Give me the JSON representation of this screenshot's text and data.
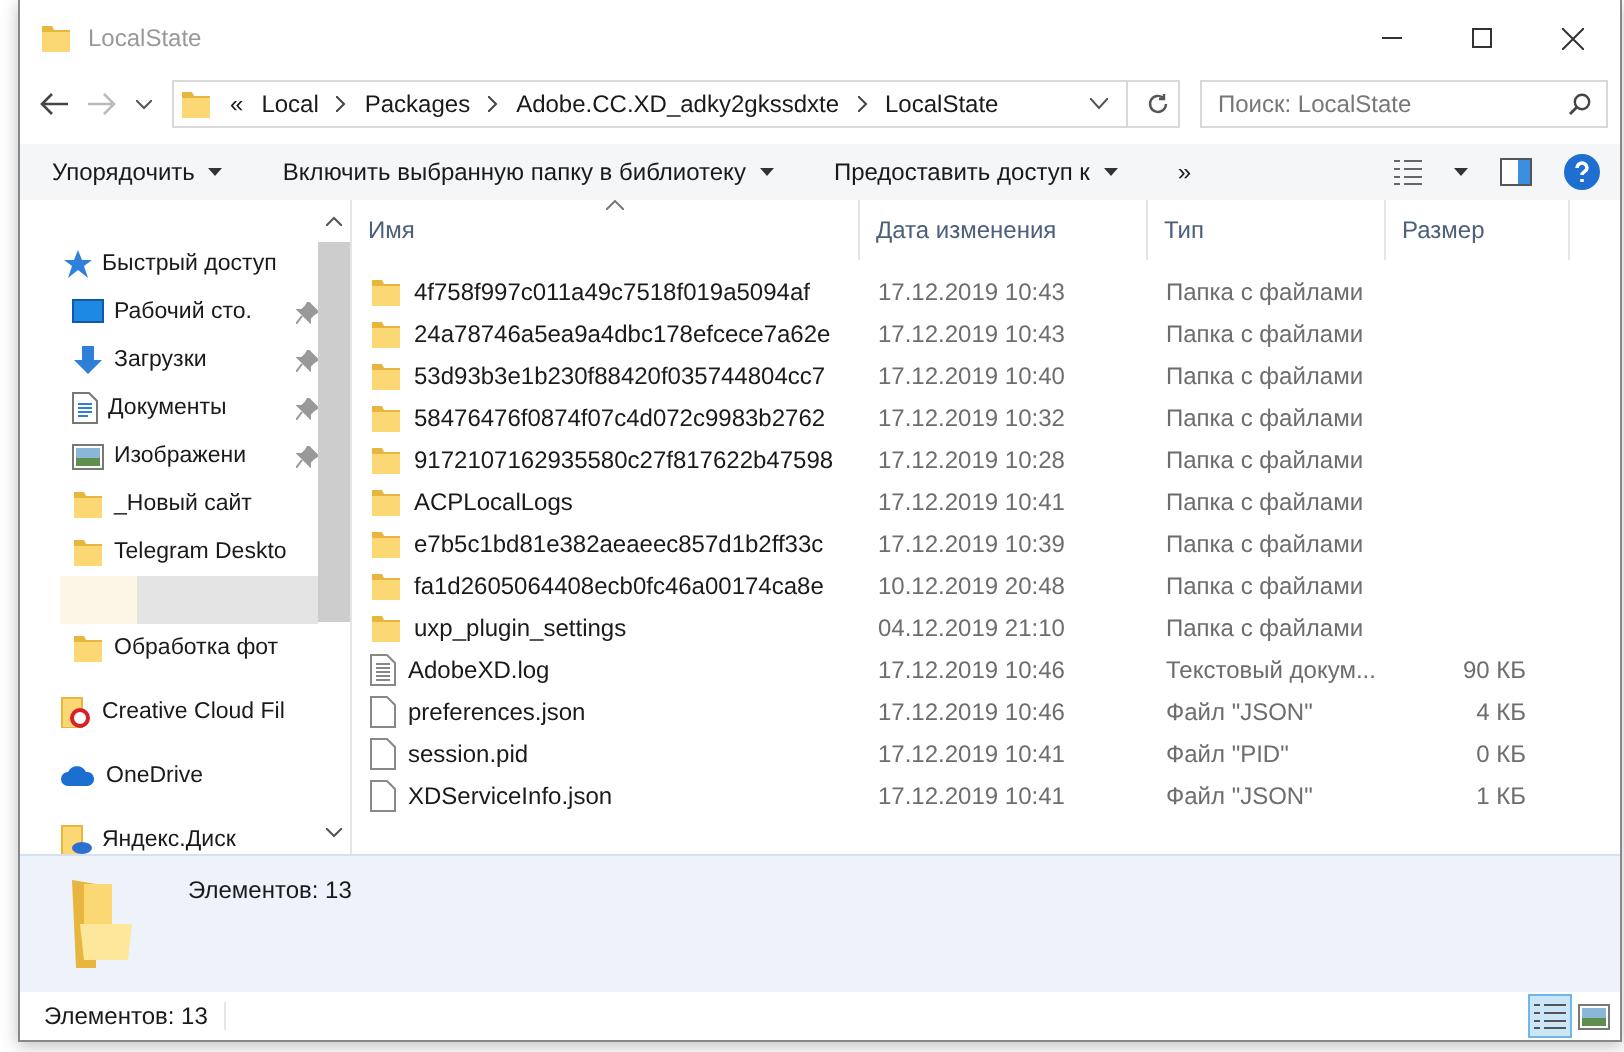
{
  "window": {
    "title": "LocalState"
  },
  "address": {
    "overflow": "«",
    "crumbs": [
      "Local",
      "Packages",
      "Adobe.CC.XD_adky2gkssdxte",
      "LocalState"
    ]
  },
  "search": {
    "placeholder": "Поиск: LocalState"
  },
  "toolbar": {
    "items": [
      {
        "label": "Упорядочить",
        "dropdown": true
      },
      {
        "label": "Включить выбранную папку в библиотеку",
        "dropdown": true
      },
      {
        "label": "Предоставить доступ к",
        "dropdown": true
      }
    ],
    "more": "»"
  },
  "sidebar": {
    "items": [
      {
        "kind": "quick",
        "label": "Быстрый доступ",
        "pinned": false
      },
      {
        "kind": "desktop",
        "label": "Рабочий сто.",
        "pinned": true
      },
      {
        "kind": "downloads",
        "label": "Загрузки",
        "pinned": true
      },
      {
        "kind": "documents",
        "label": "Документы",
        "pinned": true
      },
      {
        "kind": "images",
        "label": "Изображени",
        "pinned": true
      },
      {
        "kind": "folder",
        "label": "_Новый сайт",
        "pinned": false
      },
      {
        "kind": "folder",
        "label": "Telegram Deskto",
        "pinned": false
      },
      {
        "kind": "redacted"
      },
      {
        "kind": "folder",
        "label": "Обработка фот",
        "pinned": false
      },
      {
        "kind": "creative-cloud",
        "label": "Creative Cloud Fil",
        "pinned": false
      },
      {
        "kind": "onedrive",
        "label": "OneDrive",
        "pinned": false
      },
      {
        "kind": "yandex",
        "label": "Яндекс.Диск",
        "pinned": false
      }
    ]
  },
  "table": {
    "columns": [
      {
        "label": "Имя",
        "sorted": true
      },
      {
        "label": "Дата изменения",
        "sorted": false
      },
      {
        "label": "Тип",
        "sorted": false
      },
      {
        "label": "Размер",
        "sorted": false
      }
    ],
    "rows": [
      {
        "kind": "folder",
        "name": "4f758f997c011a49c7518f019a5094af",
        "date": "17.12.2019 10:43",
        "type": "Папка с файлами"
      },
      {
        "kind": "folder",
        "name": "24a78746a5ea9a4dbc178efcece7a62e",
        "date": "17.12.2019 10:43",
        "type": "Папка с файлами"
      },
      {
        "kind": "folder",
        "name": "53d93b3e1b230f88420f035744804cc7",
        "date": "17.12.2019 10:40",
        "type": "Папка с файлами"
      },
      {
        "kind": "folder",
        "name": "58476476f0874f07c4d072c9983b2762",
        "date": "17.12.2019 10:32",
        "type": "Папка с файлами"
      },
      {
        "kind": "folder",
        "name": "9172107162935580c27f817622b47598",
        "date": "17.12.2019 10:28",
        "type": "Папка с файлами"
      },
      {
        "kind": "folder",
        "name": "ACPLocalLogs",
        "date": "17.12.2019 10:41",
        "type": "Папка с файлами"
      },
      {
        "kind": "folder",
        "name": "e7b5c1bd81e382aeaeec857d1b2ff33c",
        "date": "17.12.2019 10:39",
        "type": "Папка с файлами"
      },
      {
        "kind": "folder",
        "name": "fa1d2605064408ecb0fc46a00174ca8e",
        "date": "10.12.2019 20:48",
        "type": "Папка с файлами"
      },
      {
        "kind": "folder",
        "name": "uxp_plugin_settings",
        "date": "04.12.2019 21:10",
        "type": "Папка с файлами"
      },
      {
        "kind": "text",
        "name": "AdobeXD.log",
        "date": "17.12.2019 10:46",
        "type": "Текстовый докум...",
        "size": "90 КБ"
      },
      {
        "kind": "file",
        "name": "preferences.json",
        "date": "17.12.2019 10:46",
        "type": "Файл \"JSON\"",
        "size": "4 КБ"
      },
      {
        "kind": "file",
        "name": "session.pid",
        "date": "17.12.2019 10:41",
        "type": "Файл \"PID\"",
        "size": "0 КБ"
      },
      {
        "kind": "file",
        "name": "XDServiceInfo.json",
        "date": "17.12.2019 10:41",
        "type": "Файл \"JSON\"",
        "size": "1 КБ"
      }
    ]
  },
  "details": {
    "text": "Элементов: 13"
  },
  "status_bar": {
    "text": "Элементов: 13",
    "views": [
      {
        "kind": "details",
        "selected": true
      },
      {
        "kind": "tiles",
        "selected": false
      }
    ]
  }
}
